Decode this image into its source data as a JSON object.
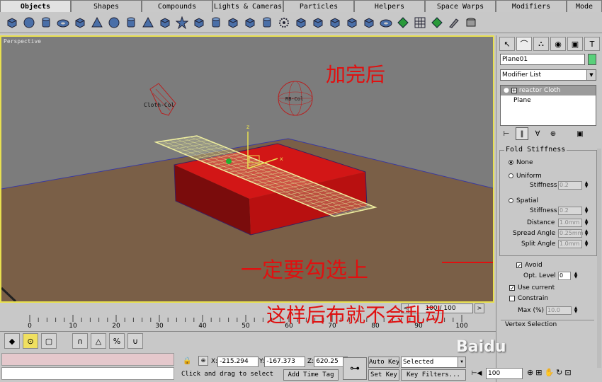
{
  "tabs": [
    {
      "label": "Objects",
      "active": true
    },
    {
      "label": "Shapes"
    },
    {
      "label": "Compounds"
    },
    {
      "label": "Lights & Cameras"
    },
    {
      "label": "Particles"
    },
    {
      "label": "Helpers"
    },
    {
      "label": "Space Warps"
    },
    {
      "label": "Modifiers"
    },
    {
      "label": "Mode"
    }
  ],
  "toolbar_icons": [
    "box-icon",
    "sphere-icon",
    "cylinder-icon",
    "torus-icon",
    "teapot-icon",
    "cone-icon",
    "geosphere-icon",
    "tube-icon",
    "pyramid-icon",
    "plane-icon",
    "hedra-icon",
    "chamferbox-icon",
    "oiltank-icon",
    "spindle-icon",
    "gengon-icon",
    "capsule-icon",
    "gear-icon",
    "torusknot-icon",
    "l-ext-icon",
    "c-ext-icon",
    "prism-icon",
    "hose-icon",
    "ringwave-icon",
    "patch-icon",
    "grid-icon",
    "extended-icon",
    "brush-icon",
    "stack-icon"
  ],
  "viewport": {
    "label": "Perspective",
    "obj_cloth_label": "Cloth-Col",
    "obj_rb_label": "RB-Col",
    "axis_z": "z",
    "axis_x": "x",
    "colors": {
      "floor": "#7a5f47",
      "box": "#b81010",
      "cloth": "#e8e8a0",
      "bg": "#7c7c7c"
    }
  },
  "annotations": {
    "top": "加完后",
    "middle": "一定要勾选上",
    "bottom": "这样后布就不会乱动"
  },
  "panel": {
    "tab_icons": [
      "create-icon",
      "modify-icon",
      "hierarchy-icon",
      "motion-icon",
      "display-icon",
      "utilities-icon"
    ],
    "object_name": "Plane01",
    "object_color": "#58d07a",
    "modifier_list": "Modifier List",
    "stack": [
      {
        "label": "reactor Cloth",
        "selected": true
      },
      {
        "label": "Plane",
        "selected": false
      }
    ],
    "fold": {
      "title": "Fold Stiffness",
      "none": "None",
      "uniform": "Uniform",
      "stiffness_label": "Stiffness",
      "uniform_stiffness": "0.2",
      "spatial": "Spatial",
      "spatial_stiffness": "0.2",
      "distance_label": "Distance",
      "distance": "1.0mm",
      "spread_label": "Spread Angle",
      "spread": "0.25mm",
      "split_label": "Split Angle",
      "split": "1.0mm"
    },
    "avoid": "Avoid",
    "opt_level_label": "Opt. Level",
    "opt_level": "0",
    "use_current": "Use current",
    "constrain": "Constrain",
    "max_label": "Max (%)",
    "max": "10.0",
    "selection": "Vertex Selection"
  },
  "timeslider": {
    "value": "100 / 100",
    "left": "<",
    "right": ">"
  },
  "trackbar": {
    "ticks": [
      "0",
      "10",
      "20",
      "30",
      "40",
      "50",
      "60",
      "70",
      "80",
      "90",
      "100"
    ]
  },
  "bottom": {
    "x_label": "X:",
    "x": "-215.294",
    "y_label": "Y:",
    "y": "-167.373",
    "z_label": "Z:",
    "z": "620.25",
    "prompt": "Click and drag to select",
    "add_time_tag": "Add Time Tag",
    "auto_key": "Auto Key",
    "set_key": "Set Key",
    "selected": "Selected",
    "key_filters": "Key Filters...",
    "frame": "100",
    "watermark": "Baidu"
  }
}
